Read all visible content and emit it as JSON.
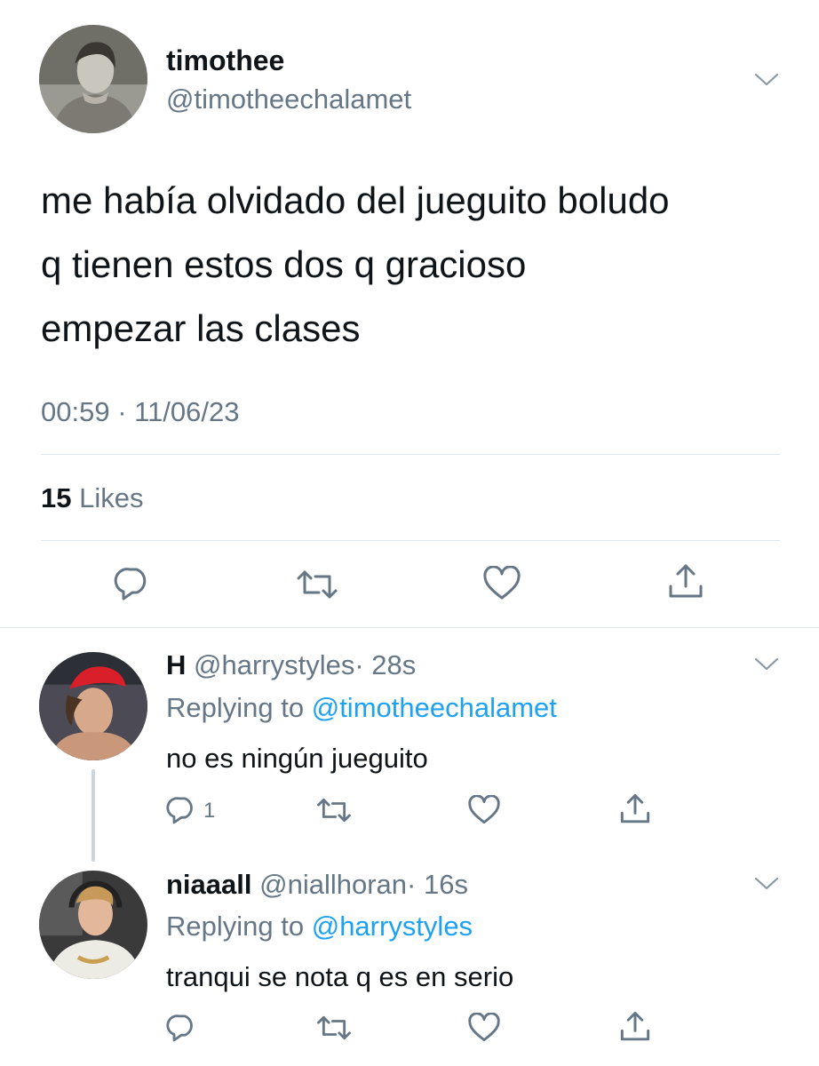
{
  "main_tweet": {
    "display_name": "timothee",
    "handle": "@timotheechalamet",
    "text_lines": [
      "me había olvidado del jueguito boludo",
      "q tienen estos dos q gracioso",
      "empezar las clases"
    ],
    "timestamp": "00:59 · 11/06/23",
    "likes_count": "15",
    "likes_label": "Likes"
  },
  "replies": [
    {
      "display_name": "H",
      "handle": "@harrystyles",
      "time": "· 28s",
      "replying_label": "Replying to",
      "replying_to": "@timotheechalamet",
      "text": "no es ningún jueguito",
      "reply_count": "1"
    },
    {
      "display_name": "niaaall",
      "handle": "@niallhoran",
      "time": "· 16s",
      "replying_label": "Replying to",
      "replying_to": "@harrystyles",
      "text": "tranqui se nota q es en serio",
      "reply_count": ""
    }
  ],
  "colors": {
    "link": "#1da1f2",
    "muted": "#657786",
    "divider": "#e1e8ed",
    "text": "#0f1419"
  },
  "icons": [
    "reply-icon",
    "retweet-icon",
    "like-icon",
    "share-icon",
    "chevron-down-icon"
  ]
}
